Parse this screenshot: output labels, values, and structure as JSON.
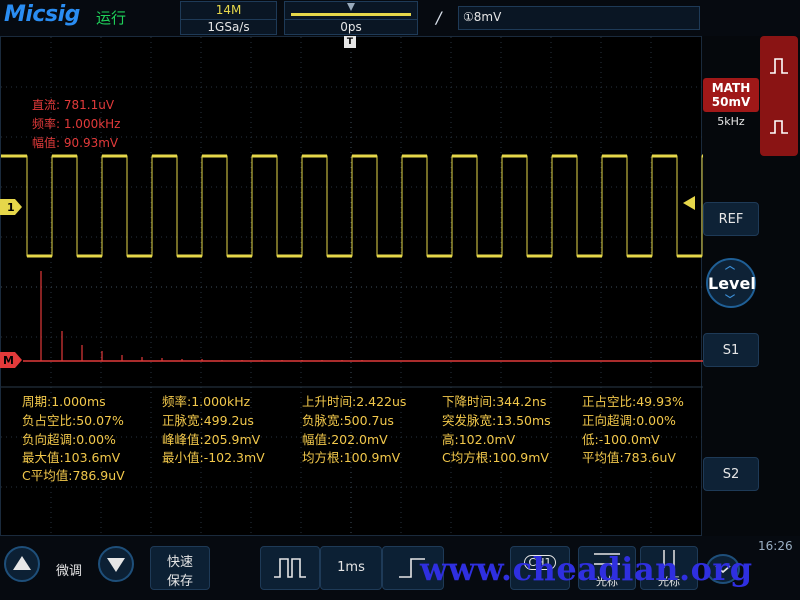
{
  "header": {
    "brand": "Micsig",
    "run_state": "运行",
    "memory_depth": "14M",
    "sample_rate": "1GSa/s",
    "trigger_position": "0ps",
    "trigger_slope_symbol": "/",
    "trigger_level": "①8mV"
  },
  "channel_markers": {
    "ch1": "1",
    "math": "M",
    "trigger_time_marker": "T"
  },
  "math_measure": {
    "dc": "直流: 781.1uV",
    "freq": "频率: 1.000kHz",
    "amp": "幅值: 90.93mV"
  },
  "measurements": [
    "周期:1.000ms",
    "频率:1.000kHz",
    "上升时间:2.422us",
    "下降时间:344.2ns",
    "正占空比:49.93%",
    "负占空比:50.07%",
    "正脉宽:499.2us",
    "负脉宽:500.7us",
    "突发脉宽:13.50ms",
    "正向超调:0.00%",
    "负向超调:0.00%",
    "峰峰值:205.9mV",
    "幅值:202.0mV",
    "高:102.0mV",
    "低:-100.0mV",
    "最大值:103.6mV",
    "最小值:-102.3mV",
    "均方根:100.9mV",
    "C均方根:100.9mV",
    "平均值:783.6uV",
    "C平均值:786.9uV"
  ],
  "right_panel": {
    "math_label_1": "MATH",
    "math_label_2": "50mV",
    "math_rate": "5kHz",
    "ref_button": "REF",
    "level_button": "Level",
    "s1_button": "S1",
    "s2_button": "S2"
  },
  "bottom_bar": {
    "fine_label": "微调",
    "quick_save_1": "快速",
    "quick_save_2": "保存",
    "timebase": "1ms",
    "channel_button": "CH1",
    "cursor_1": "光标",
    "cursor_2": "光标",
    "clock": "16:26",
    "watermark": "www.cheadian.org"
  },
  "colors": {
    "ch1": "#e6d74a",
    "math": "#e23a3a",
    "accent": "#2a8df2"
  }
}
